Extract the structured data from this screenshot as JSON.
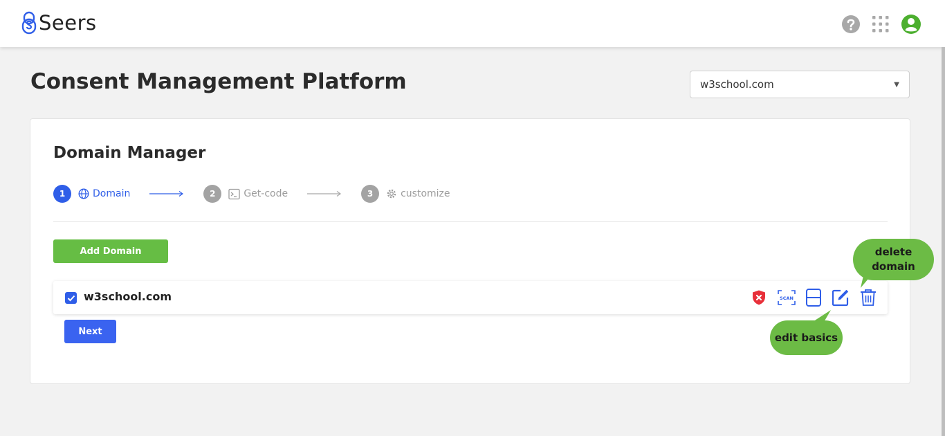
{
  "app": {
    "logo_text": "Seers"
  },
  "header": {
    "icons": [
      "help-icon",
      "apps-grid-icon",
      "user-account-icon"
    ]
  },
  "page": {
    "title": "Consent Management Platform"
  },
  "domain_selector": {
    "selected": "w3school.com"
  },
  "card": {
    "title": "Domain Manager",
    "steps": [
      {
        "number": "1",
        "label": "Domain",
        "icon": "globe-icon",
        "state": "active"
      },
      {
        "number": "2",
        "label": "Get-code",
        "icon": "terminal-icon",
        "state": "inactive"
      },
      {
        "number": "3",
        "label": "customize",
        "icon": "gear-icon",
        "state": "inactive"
      }
    ],
    "add_button_label": "Add Domain",
    "domain_row": {
      "name": "w3school.com",
      "checked": true,
      "actions": [
        "security-shield-icon",
        "scan-icon",
        "document-icon",
        "edit-icon",
        "trash-icon"
      ]
    },
    "next_button_label": "Next"
  },
  "annotations": {
    "delete_domain": "delete domain",
    "edit_basics": "edit basics"
  },
  "colors": {
    "primary": "#2f5ee8",
    "success": "#66bd44",
    "danger": "#e8303a",
    "annotation": "#6cbb45",
    "user_icon": "#4caf2f"
  }
}
